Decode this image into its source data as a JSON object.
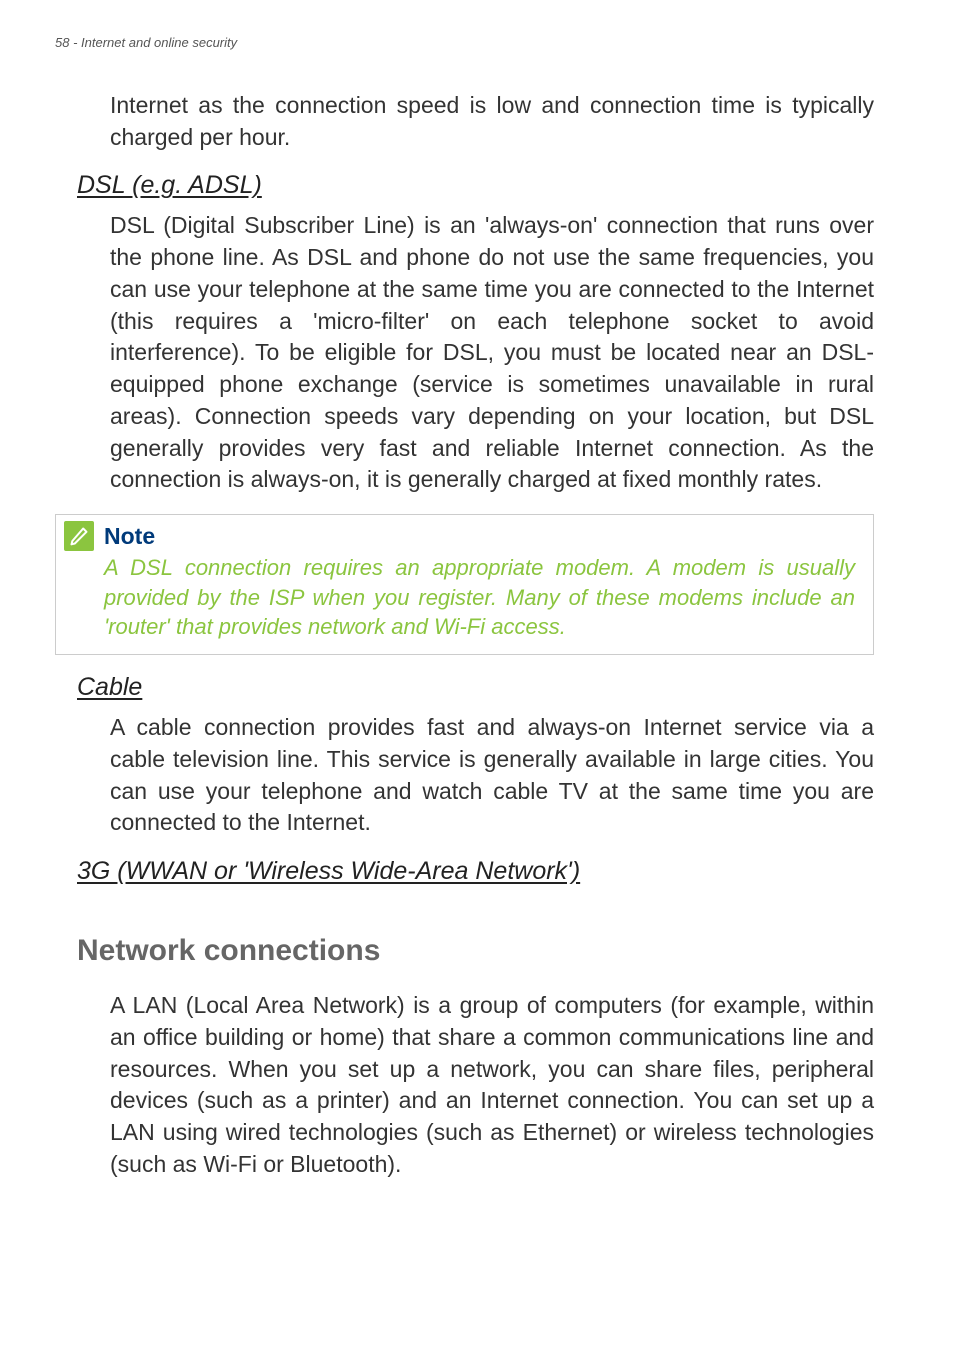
{
  "header": {
    "page_number": "58",
    "section_title": "Internet and online security"
  },
  "intro_paragraph": "Internet as the connection speed is low and connection time is typically charged per hour.",
  "dsl": {
    "heading": "DSL (e.g. ADSL)",
    "body": "DSL (Digital Subscriber Line) is an 'always-on' connection that runs over the phone line. As DSL and phone do not use the same frequencies, you can use your telephone at the same time you are connected to the Internet (this requires a 'micro-filter' on each telephone socket to avoid interference). To be eligible for DSL, you must be located near an DSL-equipped phone exchange (service is sometimes unavailable in rural areas). Connection speeds vary depending on your location, but DSL generally provides very fast and reliable Internet connection. As the connection is always-on, it is generally charged at fixed monthly rates."
  },
  "note": {
    "title": "Note",
    "body": "A DSL connection requires an appropriate modem. A modem is usually provided by the ISP when you register. Many of these modems include an 'router' that provides network and Wi-Fi access."
  },
  "cable": {
    "heading": "Cable",
    "body": "A cable connection provides fast and always-on Internet service via a cable television line. This service is generally available in large cities. You can use your telephone and watch cable TV at the same time you are connected to the Internet."
  },
  "wwan": {
    "heading": "3G (WWAN or 'Wireless Wide-Area Network')"
  },
  "network_connections": {
    "heading": "Network connections",
    "body": "A LAN (Local Area Network) is a group of computers (for example, within an office building or home) that share a common communications line and resources. When you set up a network, you can share files, peripheral devices (such as a printer) and an Internet connection. You can set up a LAN using wired technologies (such as Ethernet) or wireless technologies (such as Wi-Fi or Bluetooth)."
  }
}
